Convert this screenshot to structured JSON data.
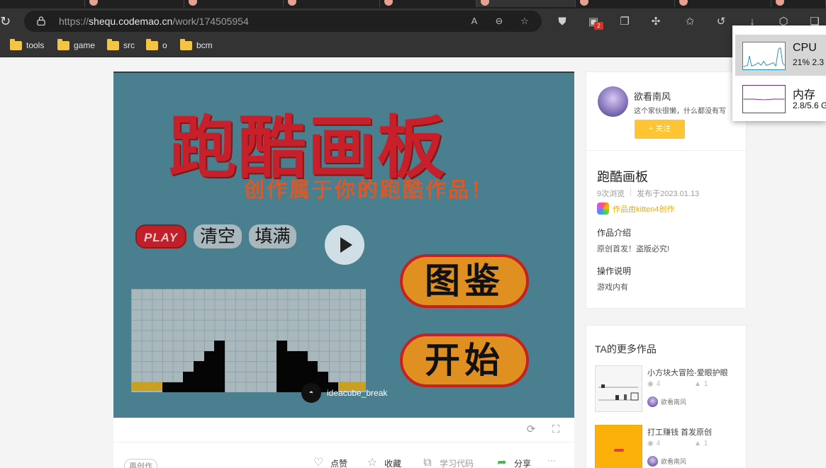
{
  "browser": {
    "url_prefix": "https://",
    "url_host": "shequ.codemao.cn",
    "url_path": "/work/174505954",
    "extension_badge": "2",
    "bookmarks": [
      "tools",
      "game",
      "src",
      "o",
      "bcm"
    ]
  },
  "player": {
    "title": "跑酷画板",
    "subtitle": "创作属于你的跑酷作品！",
    "btn_play": "PLAY",
    "btn_clear": "清空",
    "btn_fill": "填满",
    "btn_gallery": "图鉴",
    "btn_start": "开始",
    "author_chip": "ideacube_break"
  },
  "actions": {
    "remix": "再创作",
    "like": "点赞",
    "collect": "收藏",
    "learn_code": "学习代码",
    "share": "分享",
    "more": "···"
  },
  "author": {
    "name": "欲看南风",
    "bio": "这个家伙很懒，什么都没有写",
    "follow_label": "+ 关注"
  },
  "work": {
    "title": "跑酷画板",
    "views": "9次浏览",
    "published": "发布于2023.01.13",
    "made_with": "作品由kitten4创作",
    "intro_heading": "作品介绍",
    "intro_text": "原创首发！盗版必究!",
    "ops_heading": "操作说明",
    "ops_text": "游戏内有"
  },
  "more_works": {
    "heading": "TA的更多作品",
    "items": [
      {
        "title": "小方块大冒险-爱眼护眼",
        "views": "4",
        "likes": "1",
        "author": "欲看南风"
      },
      {
        "title": "打工赚钱 首发原创",
        "views": "4",
        "likes": "1",
        "author": "欲看南风"
      }
    ]
  },
  "perf_popup": {
    "cpu_label": "CPU",
    "cpu_value": "21% 2.3",
    "mem_label": "内存",
    "mem_value": "2.8/5.6 G"
  },
  "colors": {
    "follow_button": "#fec433",
    "game_background": "#4a7f8f",
    "game_title": "#c8202a",
    "kitten_link": "#f2a900"
  },
  "icons": [
    "refresh-icon",
    "lock-icon",
    "zoom-icon",
    "favorite-add-icon",
    "shield-icon",
    "extension-icon",
    "collections-icon",
    "puzzle-icon",
    "favorites-icon",
    "history-icon",
    "download-icon",
    "security-icon",
    "tab-icon",
    "folder-icon",
    "play-icon",
    "rotate-icon",
    "fullscreen-icon",
    "like-icon",
    "collect-icon",
    "code-icon",
    "share-icon",
    "eye-icon",
    "thumb-icon"
  ]
}
